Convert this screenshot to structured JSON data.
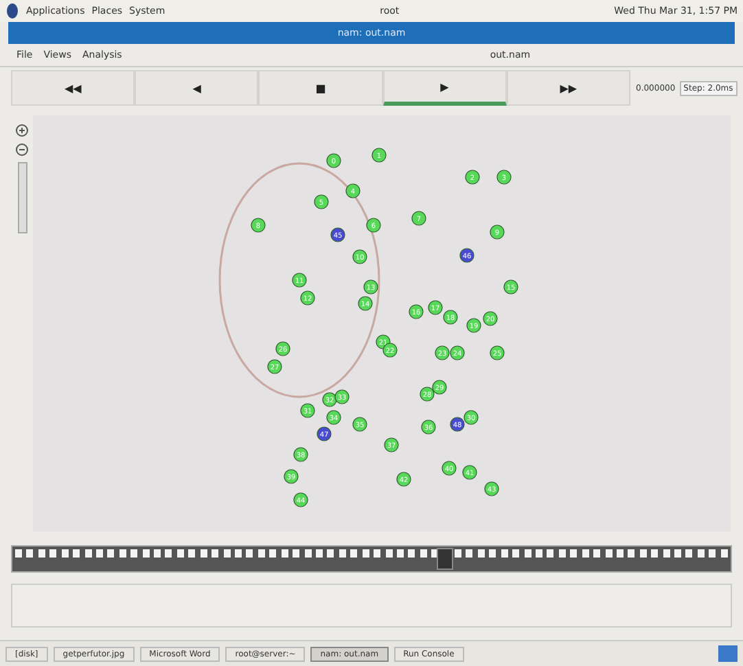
{
  "top_panel": {
    "menus": [
      "Applications",
      "Places",
      "System"
    ],
    "user": "root",
    "clock": "Wed Thu Mar 31, 1:57 PM"
  },
  "window": {
    "title": "nam: out.nam"
  },
  "menu": [
    "File",
    "Views",
    "Analysis"
  ],
  "file_name": "out.nam",
  "controls": [
    {
      "label": "◀◀",
      "selected": false
    },
    {
      "label": "◀",
      "selected": false
    },
    {
      "label": "■",
      "selected": false
    },
    {
      "label": "▶",
      "selected": true
    },
    {
      "label": "▶▶",
      "selected": false
    }
  ],
  "time": "0.000000",
  "step": "Step: 2.0ms",
  "timeline": {
    "level": 0.59
  },
  "nodes": [
    {
      "label": "0",
      "color": "#58d858"
    },
    {
      "label": "1",
      "color": "#58d858"
    },
    {
      "label": "2",
      "color": "#58d858"
    },
    {
      "label": "3",
      "color": "#58d858"
    },
    {
      "label": "4",
      "color": "#58d858"
    },
    {
      "label": "5",
      "color": "#58d858"
    },
    {
      "label": "6",
      "color": "#58d858"
    },
    {
      "label": "7",
      "color": "#58d858"
    },
    {
      "label": "8",
      "color": "#58d858"
    },
    {
      "label": "9",
      "color": "#58d858"
    },
    {
      "label": "10",
      "color": "#58d858"
    },
    {
      "label": "11",
      "color": "#58d858"
    },
    {
      "label": "12",
      "color": "#58d858"
    },
    {
      "label": "13",
      "color": "#58d858"
    },
    {
      "label": "14",
      "color": "#58d858"
    },
    {
      "label": "15",
      "color": "#58d858"
    },
    {
      "label": "16",
      "color": "#58d858"
    },
    {
      "label": "17",
      "color": "#58d858"
    },
    {
      "label": "18",
      "color": "#58d858"
    },
    {
      "label": "19",
      "color": "#58d858"
    },
    {
      "label": "20",
      "color": "#58d858"
    },
    {
      "label": "21",
      "color": "#58d858"
    },
    {
      "label": "22",
      "color": "#58d858"
    },
    {
      "label": "23",
      "color": "#58d858"
    },
    {
      "label": "24",
      "color": "#58d858"
    },
    {
      "label": "25",
      "color": "#58d858"
    },
    {
      "label": "26",
      "color": "#58d858"
    },
    {
      "label": "27",
      "color": "#58d858"
    },
    {
      "label": "28",
      "color": "#58d858"
    },
    {
      "label": "29",
      "color": "#58d858"
    },
    {
      "label": "30",
      "color": "#58d858"
    },
    {
      "label": "31",
      "color": "#58d858"
    },
    {
      "label": "32",
      "color": "#58d858"
    },
    {
      "label": "33",
      "color": "#58d858"
    },
    {
      "label": "34",
      "color": "#58d858"
    },
    {
      "label": "35",
      "color": "#58d858"
    },
    {
      "label": "36",
      "color": "#58d858"
    },
    {
      "label": "37",
      "color": "#58d858"
    },
    {
      "label": "38",
      "color": "#58d858"
    },
    {
      "label": "39",
      "color": "#58d858"
    },
    {
      "label": "40",
      "color": "#58d858"
    },
    {
      "label": "41",
      "color": "#58d858"
    },
    {
      "label": "42",
      "color": "#58d858"
    },
    {
      "label": "43",
      "color": "#58d858"
    },
    {
      "label": "44",
      "color": "#58d858"
    },
    {
      "label": "45",
      "color": "#4a4ad0"
    },
    {
      "label": "46",
      "color": "#4a4ad0"
    },
    {
      "label": "47",
      "color": "#4a4ad0"
    },
    {
      "label": "48",
      "color": "#4a4ad0"
    }
  ],
  "taskbar": [
    {
      "label": "[disk]",
      "selected": false
    },
    {
      "label": "getperfutor.jpg",
      "selected": false
    },
    {
      "label": "Microsoft Word",
      "selected": false
    },
    {
      "label": "root@server:~",
      "selected": false
    },
    {
      "label": "nam: out.nam",
      "selected": true
    },
    {
      "label": "Run Console",
      "selected": false
    }
  ]
}
